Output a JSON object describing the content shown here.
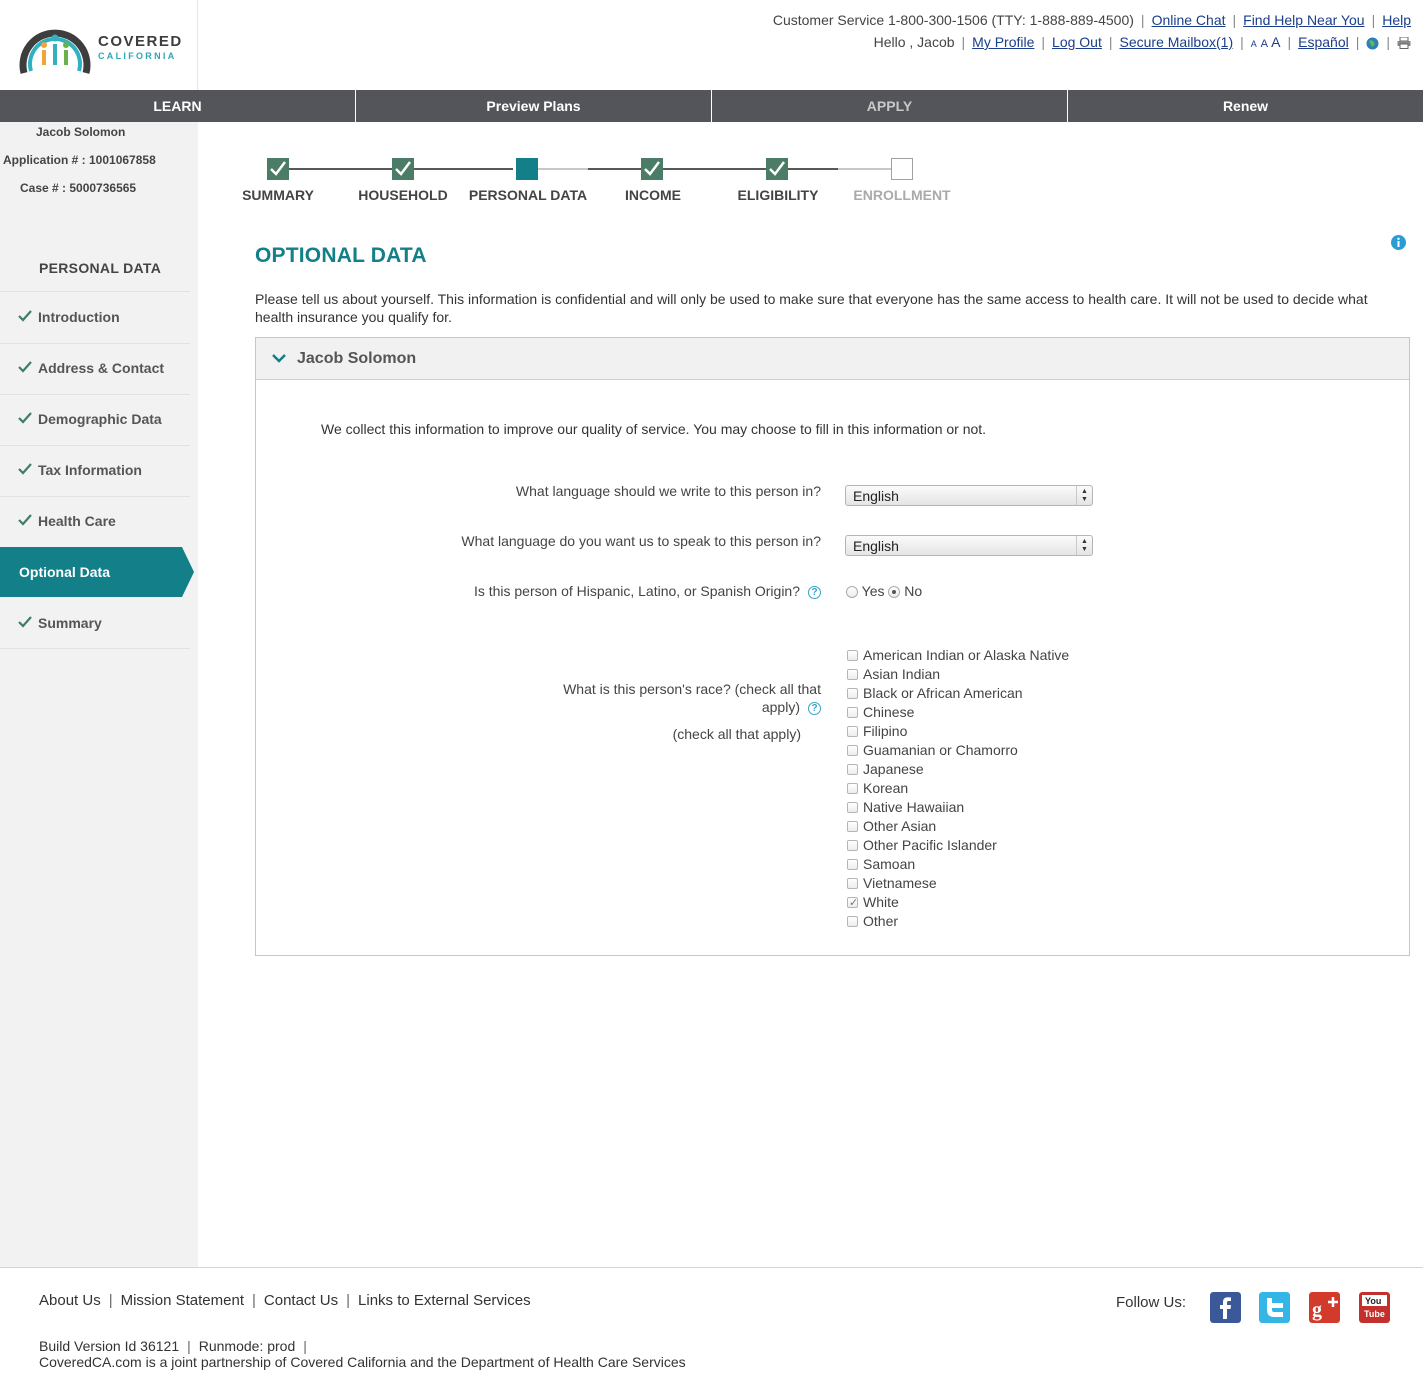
{
  "brand": {
    "line1": "COVERED",
    "line2": "CALIFORNIA"
  },
  "utility": {
    "customer_service": "Customer Service 1-800-300-1506 (TTY: 1-888-889-4500)",
    "online_chat": "Online Chat",
    "find_help": "Find Help Near You",
    "help": "Help",
    "greeting": "Hello , Jacob",
    "my_profile": "My Profile",
    "log_out": "Log Out",
    "secure_mailbox": "Secure Mailbox(1)",
    "font_small": "A",
    "font_medium": "A",
    "font_large": "A",
    "espanol": "Español"
  },
  "nav": {
    "tabs": [
      {
        "label": "LEARN"
      },
      {
        "label": "Preview Plans"
      },
      {
        "label": "APPLY"
      },
      {
        "label": "Renew"
      }
    ]
  },
  "sidebar": {
    "user_name": "Jacob Solomon",
    "application": "Application # : 1001067858",
    "case": "Case # : 5000736565",
    "section_title": "PERSONAL DATA",
    "items": [
      {
        "label": "Introduction",
        "done": true
      },
      {
        "label": "Address & Contact",
        "done": true
      },
      {
        "label": "Demographic Data",
        "done": true
      },
      {
        "label": "Tax Information",
        "done": true
      },
      {
        "label": "Health Care",
        "done": true
      },
      {
        "label": "Optional Data",
        "active": true
      },
      {
        "label": "Summary",
        "done": true
      }
    ]
  },
  "progress": {
    "steps": [
      {
        "label": "SUMMARY",
        "state": "done"
      },
      {
        "label": "HOUSEHOLD",
        "state": "done"
      },
      {
        "label": "PERSONAL DATA",
        "state": "current"
      },
      {
        "label": "INCOME",
        "state": "done"
      },
      {
        "label": "ELIGIBILITY",
        "state": "done"
      },
      {
        "label": "ENROLLMENT",
        "state": "empty"
      }
    ]
  },
  "main": {
    "title": "OPTIONAL DATA",
    "intro": "Please tell us about yourself. This information is confidential and will only be used to make sure that everyone has the same access to health care. It will not be used to decide what health insurance you qualify for.",
    "person_name": "Jacob Solomon",
    "collect_text": "We collect this information to improve our quality of service. You may choose to fill in this information or not.",
    "q_write_language": "What language should we write to this person in?",
    "write_language_value": "English",
    "q_speak_language": "What language do you want us to speak to this person in?",
    "speak_language_value": "English",
    "q_hispanic": "Is this person of Hispanic, Latino, or Spanish Origin?",
    "hispanic_yes": "Yes",
    "hispanic_no": "No",
    "hispanic_selected": "No",
    "q_race_line1": "What is this person's race? (check all that",
    "q_race_line2": "apply)",
    "q_race_hint": "(check all that apply)",
    "race_options": [
      {
        "label": "American Indian or Alaska Native",
        "checked": false
      },
      {
        "label": "Asian Indian",
        "checked": false
      },
      {
        "label": "Black or African American",
        "checked": false
      },
      {
        "label": "Chinese",
        "checked": false
      },
      {
        "label": "Filipino",
        "checked": false
      },
      {
        "label": "Guamanian or Chamorro",
        "checked": false
      },
      {
        "label": "Japanese",
        "checked": false
      },
      {
        "label": "Korean",
        "checked": false
      },
      {
        "label": "Native Hawaiian",
        "checked": false
      },
      {
        "label": "Other Asian",
        "checked": false
      },
      {
        "label": "Other Pacific Islander",
        "checked": false
      },
      {
        "label": "Samoan",
        "checked": false
      },
      {
        "label": "Vietnamese",
        "checked": false
      },
      {
        "label": "White",
        "checked": true
      },
      {
        "label": "Other",
        "checked": false
      }
    ]
  },
  "footer": {
    "links": [
      "About Us",
      "Mission Statement",
      "Contact Us",
      "Links to External Services"
    ],
    "build": "Build Version Id 36121",
    "runmode": "Runmode: prod",
    "partner": "CoveredCA.com is a joint partnership of Covered California and the Department of Health Care Services",
    "follow": "Follow Us:",
    "social": [
      "facebook-icon",
      "twitter-icon",
      "google-plus-icon",
      "youtube-icon"
    ]
  },
  "colors": {
    "teal": "#127f89",
    "nav_bg": "#54555a",
    "step_done": "#4a7c66",
    "link": "#1a3e8a"
  }
}
